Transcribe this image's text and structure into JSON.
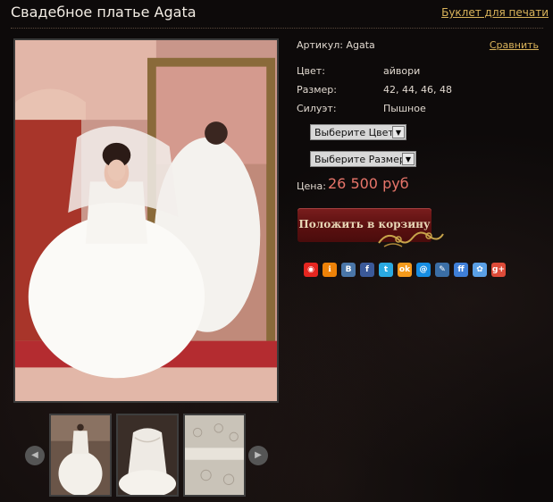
{
  "header": {
    "title": "Свадебное платье Agata",
    "print_link": "Буклет для печати"
  },
  "product": {
    "article_label": "Артикул:",
    "article_value": "Agata",
    "compare_link": "Сравнить",
    "attributes": [
      {
        "label": "Цвет:",
        "value": "айвори"
      },
      {
        "label": "Размер:",
        "value": "42, 44, 46, 48"
      },
      {
        "label": "Силуэт:",
        "value": "Пышное"
      }
    ],
    "color_select": "Выберите Цвет",
    "size_select": "Выберите Размер",
    "price_label": "Цена:",
    "price_value": "26 500 руб",
    "cart_button": "Положить в корзину"
  },
  "share": {
    "icons": [
      {
        "name": "yandex-icon",
        "glyph": "◉",
        "color": "#e52620"
      },
      {
        "name": "odnoklassniki-like-icon",
        "glyph": "ℹ",
        "color": "#ee8208"
      },
      {
        "name": "vkontakte-icon",
        "glyph": "B",
        "color": "#4a76a8"
      },
      {
        "name": "facebook-icon",
        "glyph": "f",
        "color": "#3b5998"
      },
      {
        "name": "twitter-icon",
        "glyph": "t",
        "color": "#2aa9e0"
      },
      {
        "name": "odnoklassniki-icon",
        "glyph": "ok",
        "color": "#f59a1c"
      },
      {
        "name": "mailru-icon",
        "glyph": "@",
        "color": "#168de2"
      },
      {
        "name": "livejournal-icon",
        "glyph": "✎",
        "color": "#3b6ea5"
      },
      {
        "name": "friendfeed-icon",
        "glyph": "ff",
        "color": "#3f7fd8"
      },
      {
        "name": "moikrug-icon",
        "glyph": "✿",
        "color": "#5aa0e6"
      },
      {
        "name": "googleplus-icon",
        "glyph": "g+",
        "color": "#dd4b39"
      }
    ]
  },
  "gallery": {
    "prev_label": "◀",
    "next_label": "▶",
    "thumbnails": [
      "thumb-front-dress",
      "thumb-bodice-closeup",
      "thumb-fabric-detail"
    ]
  },
  "colors": {
    "link": "#d9b35a",
    "price": "#e8756a",
    "cart_button": "#6a1616"
  }
}
